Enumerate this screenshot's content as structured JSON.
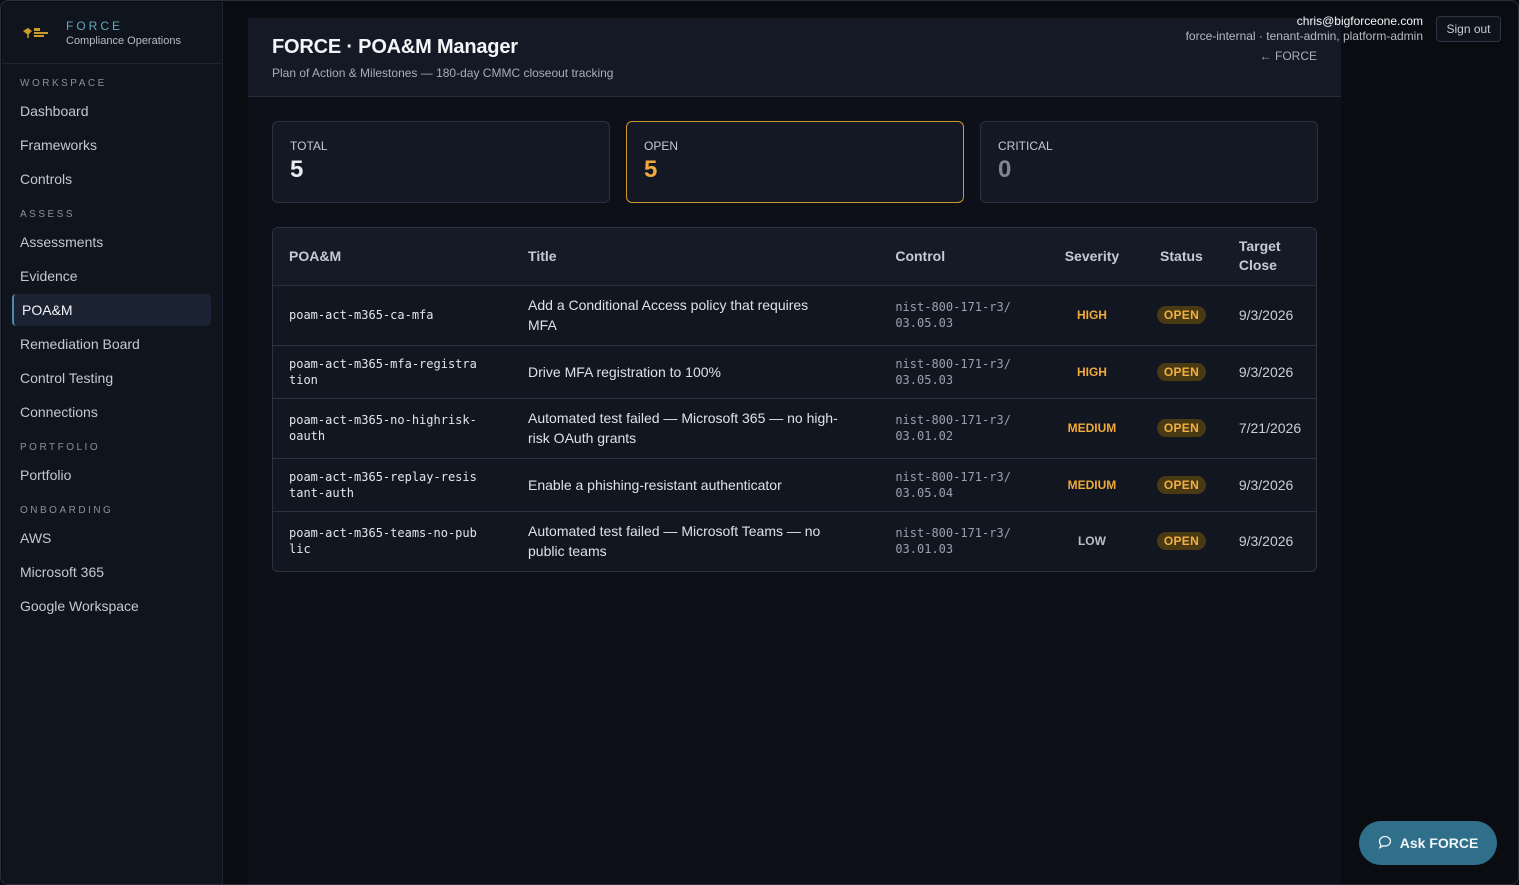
{
  "brand": {
    "name": "FORCE",
    "subtitle": "Compliance Operations"
  },
  "sidebar": {
    "sections": [
      {
        "label": "WORKSPACE",
        "items": [
          {
            "label": "Dashboard",
            "active": false
          },
          {
            "label": "Frameworks",
            "active": false
          },
          {
            "label": "Controls",
            "active": false
          }
        ]
      },
      {
        "label": "ASSESS",
        "items": [
          {
            "label": "Assessments",
            "active": false
          },
          {
            "label": "Evidence",
            "active": false
          },
          {
            "label": "POA&M",
            "active": true
          },
          {
            "label": "Remediation Board",
            "active": false
          },
          {
            "label": "Control Testing",
            "active": false
          },
          {
            "label": "Connections",
            "active": false
          }
        ]
      },
      {
        "label": "PORTFOLIO",
        "items": [
          {
            "label": "Portfolio",
            "active": false
          }
        ]
      },
      {
        "label": "ONBOARDING",
        "items": [
          {
            "label": "AWS",
            "active": false
          },
          {
            "label": "Microsoft 365",
            "active": false
          },
          {
            "label": "Google Workspace",
            "active": false
          }
        ]
      }
    ]
  },
  "user": {
    "email": "chris@bigforceone.com",
    "roles": "force-internal · tenant-admin, platform-admin",
    "signout_label": "Sign out"
  },
  "header": {
    "title": "FORCE · POA&M Manager",
    "subtitle": "Plan of Action & Milestones — 180-day CMMC closeout tracking",
    "back_link": "← FORCE"
  },
  "stats": {
    "total": {
      "label": "TOTAL",
      "value": "5"
    },
    "open": {
      "label": "OPEN",
      "value": "5"
    },
    "critical": {
      "label": "CRITICAL",
      "value": "0"
    }
  },
  "table": {
    "headers": {
      "poam": "POA&M",
      "title": "Title",
      "control": "Control",
      "severity": "Severity",
      "status": "Status",
      "target_close": "Target Close"
    },
    "rows": [
      {
        "poam": "poam-act-m365-ca-mfa",
        "title": "Add a Conditional Access policy that requires MFA",
        "control": "nist-800-171-r3/03.05.03",
        "severity": "HIGH",
        "status": "OPEN",
        "target_close": "9/3/2026"
      },
      {
        "poam": "poam-act-m365-mfa-registration",
        "title": "Drive MFA registration to 100%",
        "control": "nist-800-171-r3/03.05.03",
        "severity": "HIGH",
        "status": "OPEN",
        "target_close": "9/3/2026"
      },
      {
        "poam": "poam-act-m365-no-highrisk-oauth",
        "title": "Automated test failed — Microsoft 365 — no high-risk OAuth grants",
        "control": "nist-800-171-r3/03.01.02",
        "severity": "MEDIUM",
        "status": "OPEN",
        "target_close": "7/21/2026"
      },
      {
        "poam": "poam-act-m365-replay-resistant-auth",
        "title": "Enable a phishing-resistant authenticator",
        "control": "nist-800-171-r3/03.05.04",
        "severity": "MEDIUM",
        "status": "OPEN",
        "target_close": "9/3/2026"
      },
      {
        "poam": "poam-act-m365-teams-no-public",
        "title": "Automated test failed — Microsoft Teams — no public teams",
        "control": "nist-800-171-r3/03.01.03",
        "severity": "LOW",
        "status": "OPEN",
        "target_close": "9/3/2026"
      }
    ]
  },
  "ask_button": {
    "label": "Ask FORCE",
    "icon": "chat-bubble-icon"
  },
  "colors": {
    "accent": "#2f6f89",
    "warning": "#f0a93a",
    "brand": "#5fa9bd"
  }
}
